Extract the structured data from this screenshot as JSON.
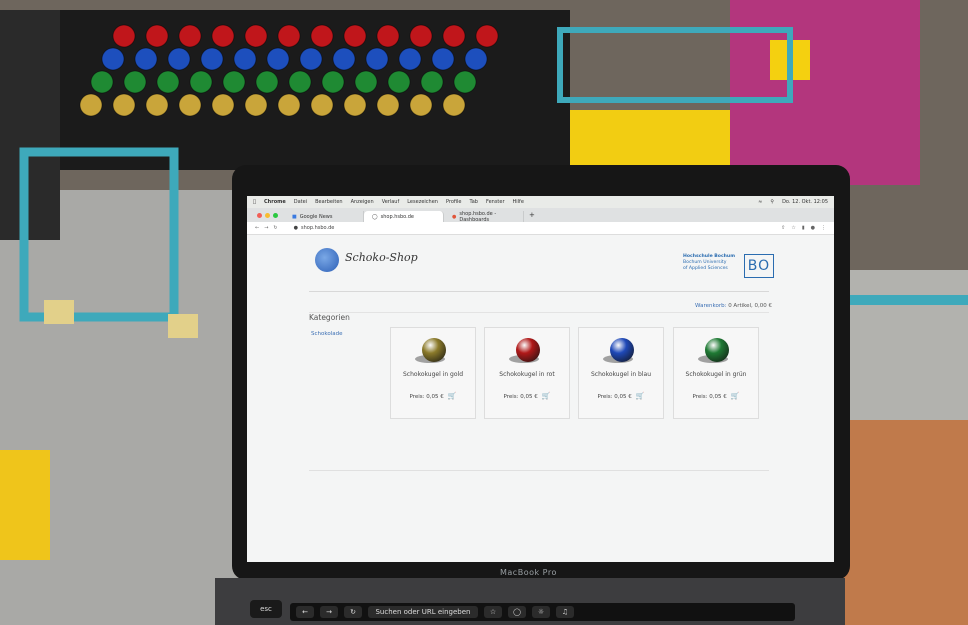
{
  "menubar": {
    "app": "Chrome",
    "items": [
      "Datei",
      "Bearbeiten",
      "Anzeigen",
      "Verlauf",
      "Lesezeichen",
      "Profile",
      "Tab",
      "Fenster",
      "Hilfe"
    ],
    "clock": "Do. 12. Okt.  12:05"
  },
  "tabs": [
    {
      "label": "Google News"
    },
    {
      "label": "shop.hsbo.de"
    },
    {
      "label": "shop.hsbo.de - Dashboards"
    }
  ],
  "address": {
    "url": "shop.hsbo.de"
  },
  "site": {
    "logo_text": "Schoko-Shop",
    "university_name": "Hochschule Bochum",
    "university_line2": "Bochum University",
    "university_line3": "of Applied Sciences",
    "university_mark": "BO",
    "cart_label": "Warenkorb:",
    "cart_value": "0 Artikel, 0,00 €",
    "categories_title": "Kategorien",
    "category_link": "Schokolade"
  },
  "products": [
    {
      "name": "Schokokugel in gold",
      "price": "Preis: 0,05 €",
      "color": "#8b7a2a"
    },
    {
      "name": "Schokokugel in rot",
      "price": "Preis: 0,05 €",
      "color": "#b01818"
    },
    {
      "name": "Schokokugel in blau",
      "price": "Preis: 0,05 €",
      "color": "#1f49b8"
    },
    {
      "name": "Schokokugel in grün",
      "price": "Preis: 0,05 €",
      "color": "#1f7a34"
    }
  ],
  "laptop": {
    "brand": "MacBook Pro"
  },
  "touchbar": {
    "esc": "esc",
    "search": "Suchen oder URL eingeben"
  },
  "photo": {
    "dispenser_rows": [
      {
        "color": "#c0161b",
        "count": 12
      },
      {
        "color": "#1d4fbd",
        "count": 12
      },
      {
        "color": "#1f8a33",
        "count": 12
      },
      {
        "color": "#c9a53a",
        "count": 12
      }
    ]
  }
}
